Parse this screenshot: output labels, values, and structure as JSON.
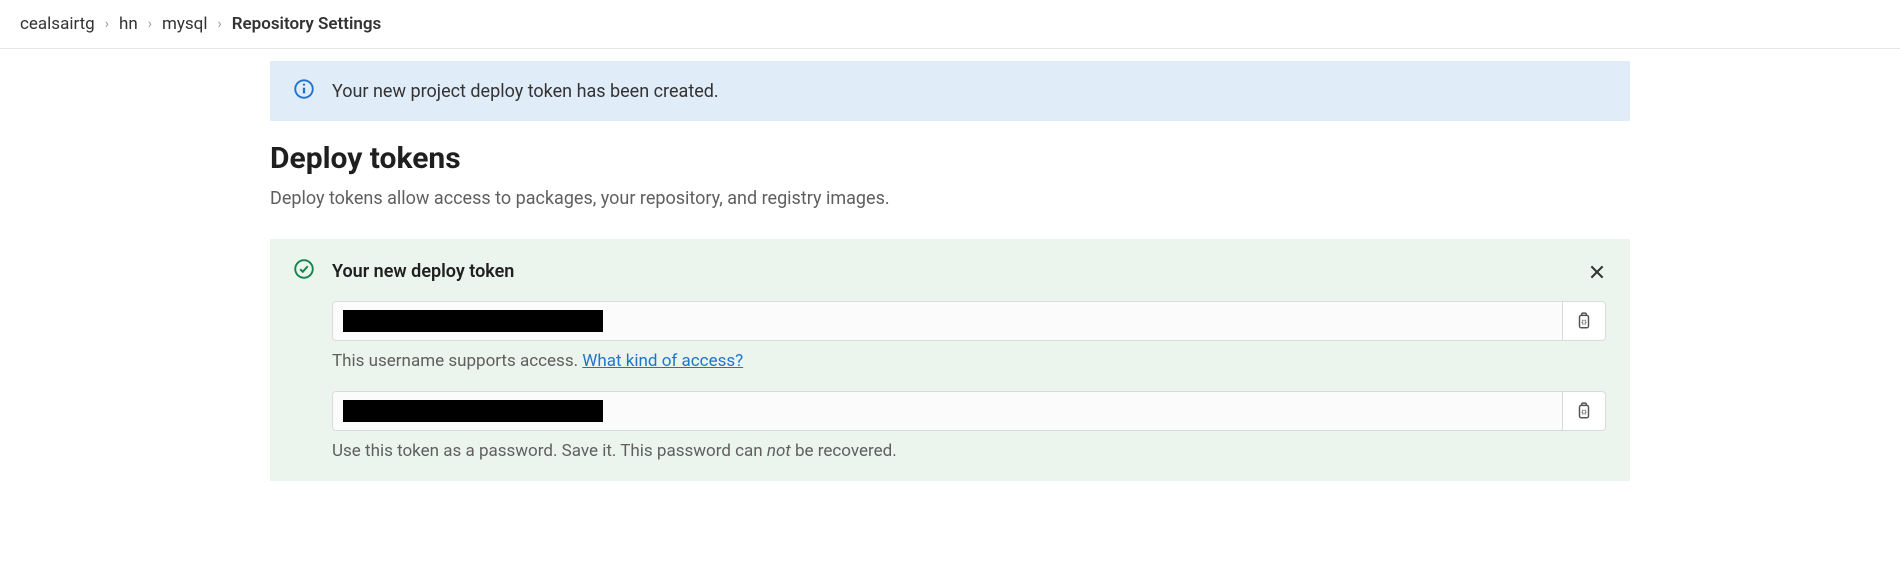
{
  "breadcrumb": {
    "items": [
      {
        "label": "cealsairtg"
      },
      {
        "label": "hn"
      },
      {
        "label": "mysql"
      },
      {
        "label": "Repository Settings"
      }
    ],
    "separator": "›"
  },
  "alert": {
    "text": "Your new project deploy token has been created."
  },
  "page": {
    "title": "Deploy tokens",
    "description": "Deploy tokens allow access to packages, your repository, and registry images."
  },
  "panel": {
    "title": "Your new deploy token",
    "username": {
      "value": "",
      "help_prefix": "This username supports access. ",
      "help_link": "What kind of access?"
    },
    "token": {
      "value": "",
      "help_prefix": "Use this token as a password. Save it. This password can ",
      "help_em": "not",
      "help_suffix": " be recovered."
    }
  }
}
